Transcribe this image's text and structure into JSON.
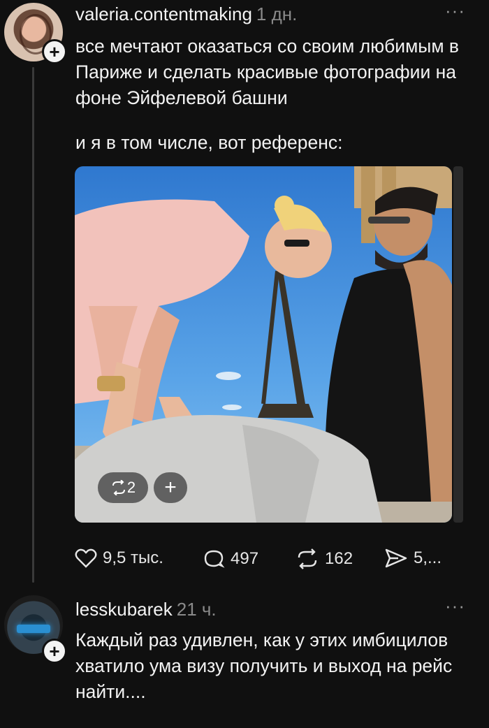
{
  "post": {
    "username": "valeria.contentmaking",
    "time": "1 дн.",
    "more": "···",
    "text_1": "все мечтают оказаться со своим любимым в Париже и сделать красивые фотографии на фоне Эйфелевой башни",
    "text_2": "и я в том числе, вот референс:",
    "image": {
      "repost_count": "2",
      "add_label": "+"
    },
    "actions": {
      "likes": "9,5 тыс.",
      "comments": "497",
      "reposts": "162",
      "shares": "5,..."
    }
  },
  "reply": {
    "username": "lesskubarek",
    "time": "21 ч.",
    "more": "···",
    "text": "Каждый раз удивлен, как у этих имбицилов хватило ума визу получить и выход на рейс найти...."
  },
  "colors": {
    "background": "#101010",
    "text": "#f3f3f3",
    "muted": "#8a8a8a",
    "thread_line": "#3a3a3a"
  },
  "icons": [
    "heart-icon",
    "comment-icon",
    "repost-icon",
    "share-icon",
    "more-icon",
    "plus-icon"
  ]
}
